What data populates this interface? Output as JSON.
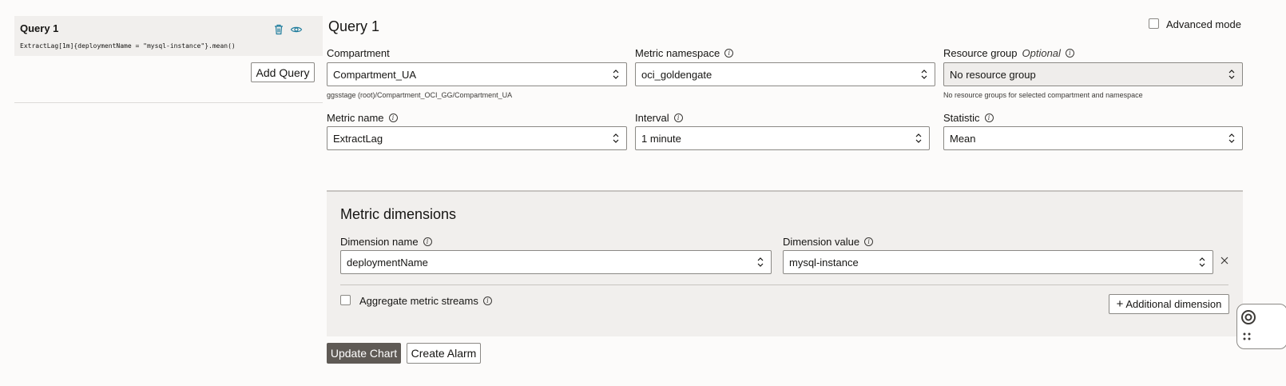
{
  "query_list": {
    "card_title": "Query 1",
    "card_expression": "ExtractLag[1m]{deploymentName = \"mysql-instance\"}.mean()",
    "add_query_label": "Add Query"
  },
  "editor": {
    "title": "Query 1",
    "advanced_mode_label": "Advanced mode",
    "compartment": {
      "label": "Compartment",
      "value": "Compartment_UA",
      "help": "ggsstage (root)/Compartment_OCI_GG/Compartment_UA"
    },
    "metric_namespace": {
      "label": "Metric namespace",
      "value": "oci_goldengate"
    },
    "resource_group": {
      "label": "Resource group",
      "optional": "Optional",
      "value": "No resource group",
      "help": "No resource groups for selected compartment and namespace"
    },
    "metric_name": {
      "label": "Metric name",
      "value": "ExtractLag"
    },
    "interval": {
      "label": "Interval",
      "value": "1 minute"
    },
    "statistic": {
      "label": "Statistic",
      "value": "Mean"
    }
  },
  "dimensions": {
    "title": "Metric dimensions",
    "name_label": "Dimension name",
    "name_value": "deploymentName",
    "value_label": "Dimension value",
    "value_value": "mysql-instance",
    "aggregate_label": "Aggregate metric streams",
    "additional_label": "Additional dimension"
  },
  "actions": {
    "update_chart": "Update Chart",
    "create_alarm": "Create Alarm"
  },
  "colors": {
    "accent": "#227e9e",
    "primary_button": "#5f5a55",
    "panel": "#f1efed"
  }
}
